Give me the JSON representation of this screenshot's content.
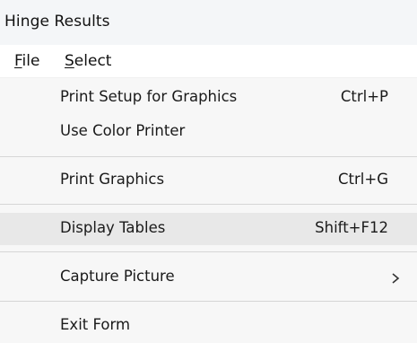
{
  "window": {
    "title": "Hinge Results"
  },
  "menubar": {
    "items": [
      {
        "label_prefix": "F",
        "label_rest": "ile"
      },
      {
        "label_prefix": "S",
        "label_rest": "elect"
      }
    ]
  },
  "dropdown": {
    "items": [
      {
        "label": "Print Setup for Graphics",
        "shortcut": "Ctrl+P"
      },
      {
        "label": "Use Color Printer",
        "shortcut": ""
      },
      {
        "label": "Print Graphics",
        "shortcut": "Ctrl+G"
      },
      {
        "label": "Display Tables",
        "shortcut": "Shift+F12"
      },
      {
        "label": "Capture Picture",
        "submenu_icon": "chevron-right-icon"
      },
      {
        "label": "Exit Form",
        "shortcut": ""
      }
    ],
    "highlighted_item": "Display Tables"
  },
  "colors": {
    "titlebar_bg": "#f4f6f8",
    "menu_bg": "#f7f7f7",
    "highlight_bg": "#e8e8e8",
    "separator": "#d6d6d6",
    "text": "#1a1a1a"
  }
}
